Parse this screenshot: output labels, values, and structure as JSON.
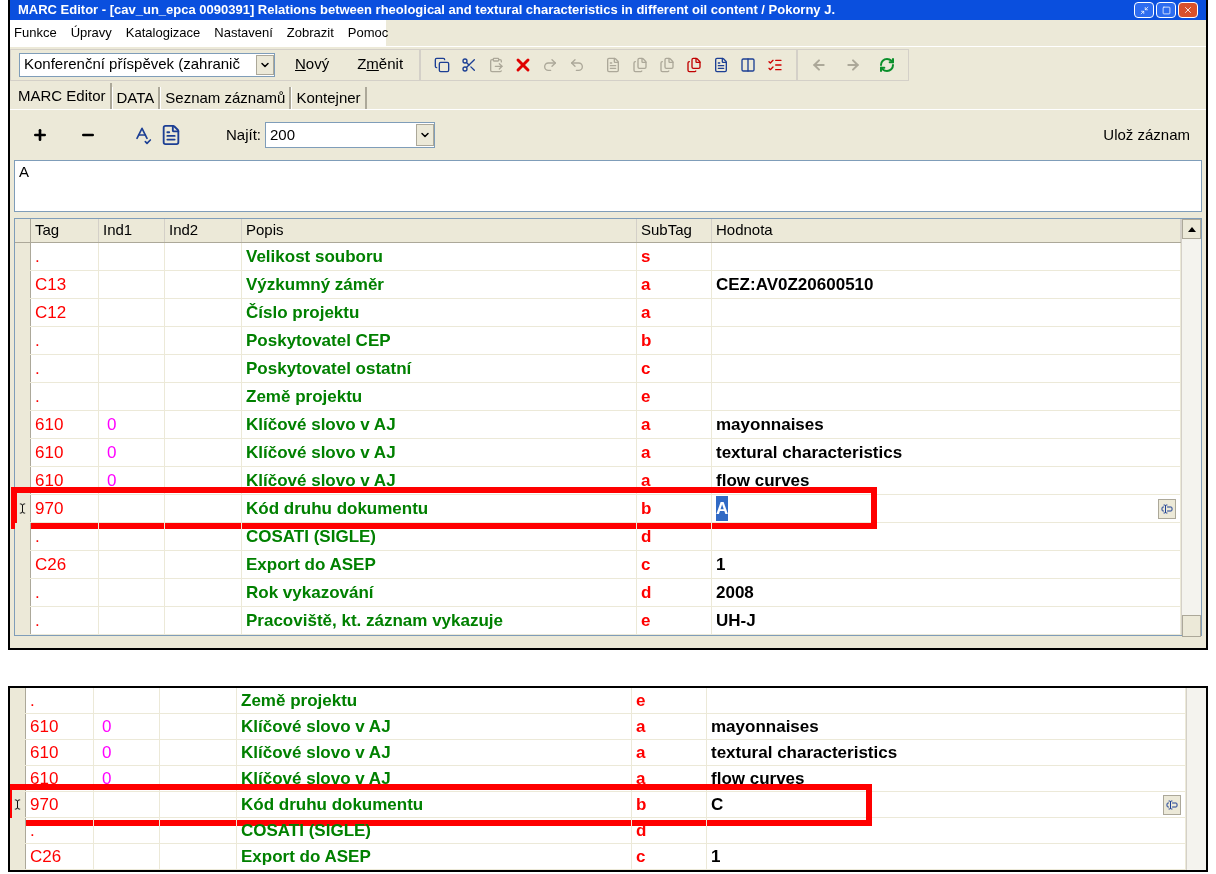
{
  "window": {
    "title": "MARC Editor - [cav_un_epca 0090391] Relations between rheological and textural characteristics in different oil content / Pokorny J."
  },
  "menu": [
    "Funkce",
    "Úpravy",
    "Katalogizace",
    "Nastavení",
    "Zobrazit",
    "Pomoc"
  ],
  "toolbar": {
    "document_type": "Konferenční příspěvek (zahranič",
    "buttons": [
      {
        "key": "N",
        "after": "ový"
      },
      {
        "before": "Z",
        "key": "m",
        "after": "ěnit"
      }
    ]
  },
  "tabs": [
    {
      "label": "MARC Editor",
      "selected": true
    },
    {
      "label": "DATA",
      "selected": false
    },
    {
      "label": "Seznam záznamů",
      "selected": false
    },
    {
      "label": "Kontejner",
      "selected": false
    }
  ],
  "find": {
    "label": "Najít:",
    "value": "200"
  },
  "save_label": "Ulož záznam",
  "note": "A",
  "columns": [
    "Tag",
    "Ind1",
    "Ind2",
    "Popis",
    "SubTag",
    "Hodnota"
  ],
  "grids": [
    {
      "rows": [
        {
          "tag": ".",
          "popis": "Velikost souboru",
          "subtag": "s",
          "current": false,
          "highlighted": false
        },
        {
          "tag": "C13",
          "popis": "Výzkumný záměr",
          "subtag": "a",
          "value": "CEZ:AV0Z20600510",
          "current": false,
          "highlighted": false,
          "value_selected": false
        },
        {
          "tag": "C12",
          "popis": "Číslo projektu",
          "subtag": "a",
          "current": false,
          "highlighted": false
        },
        {
          "tag": ".",
          "popis": "Poskytovatel CEP",
          "subtag": "b",
          "current": false,
          "highlighted": false
        },
        {
          "tag": ".",
          "popis": "Poskytovatel ostatní",
          "subtag": "c",
          "current": false,
          "highlighted": false
        },
        {
          "tag": ".",
          "popis": "Země projektu",
          "subtag": "e",
          "current": false,
          "highlighted": false
        },
        {
          "tag": "610",
          "ind1": "0",
          "popis": "Klíčové slovo v AJ",
          "subtag": "a",
          "value": "mayonnaises",
          "current": false,
          "highlighted": false,
          "value_selected": false
        },
        {
          "tag": "610",
          "ind1": "0",
          "popis": "Klíčové slovo v AJ",
          "subtag": "a",
          "value": "textural characteristics",
          "current": false,
          "highlighted": false,
          "value_selected": false
        },
        {
          "tag": "610",
          "ind1": "0",
          "popis": "Klíčové slovo v AJ",
          "subtag": "a",
          "value": "flow curves",
          "current": false,
          "highlighted": false,
          "value_selected": false
        },
        {
          "tag": "970",
          "popis": "Kód druhu dokumentu",
          "subtag": "b",
          "value": "A",
          "current": true,
          "highlighted": true,
          "value_selected": true
        },
        {
          "tag": ".",
          "popis": "COSATI (SIGLE)",
          "subtag": "d",
          "current": false,
          "highlighted": false
        },
        {
          "tag": "C26",
          "popis": "Export do ASEP",
          "subtag": "c",
          "value": "1",
          "current": false,
          "highlighted": false,
          "value_selected": false
        },
        {
          "tag": ".",
          "popis": "Rok vykazování",
          "subtag": "d",
          "value": "2008",
          "current": false,
          "highlighted": false,
          "value_selected": false
        },
        {
          "tag": ".",
          "popis": "Pracoviště, kt. záznam vykazuje",
          "subtag": "e",
          "value": "UH-J",
          "current": false,
          "highlighted": false,
          "value_selected": false
        }
      ]
    },
    {
      "rows": [
        {
          "tag": ".",
          "popis": "Země projektu",
          "subtag": "e",
          "current": false,
          "highlighted": false
        },
        {
          "tag": "610",
          "ind1": "0",
          "popis": "Klíčové slovo v AJ",
          "subtag": "a",
          "value": "mayonnaises",
          "current": false,
          "highlighted": false,
          "value_selected": false
        },
        {
          "tag": "610",
          "ind1": "0",
          "popis": "Klíčové slovo v AJ",
          "subtag": "a",
          "value": "textural characteristics",
          "current": false,
          "highlighted": false,
          "value_selected": false
        },
        {
          "tag": "610",
          "ind1": "0",
          "popis": "Klíčové slovo v AJ",
          "subtag": "a",
          "value": "flow curves",
          "current": false,
          "highlighted": false,
          "value_selected": false
        },
        {
          "tag": "970",
          "popis": "Kód druhu dokumentu",
          "subtag": "b",
          "value": "C",
          "current": true,
          "highlighted": true,
          "value_selected": false
        },
        {
          "tag": ".",
          "popis": "COSATI (SIGLE)",
          "subtag": "d",
          "current": false,
          "highlighted": false
        },
        {
          "tag": "C26",
          "popis": "Export do ASEP",
          "subtag": "c",
          "value": "1",
          "current": false,
          "highlighted": false,
          "value_selected": false
        }
      ]
    }
  ]
}
